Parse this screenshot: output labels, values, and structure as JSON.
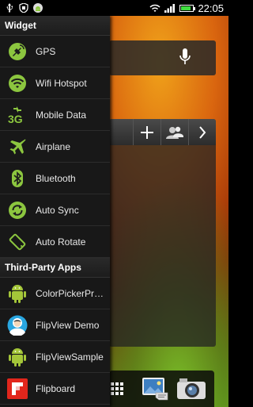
{
  "status_bar": {
    "time": "22:05",
    "icons": [
      "usb-icon",
      "security-icon",
      "android-icon",
      "wifi-icon",
      "signal-icon",
      "battery-icon"
    ],
    "battery_level": 0.85
  },
  "drawer": {
    "widget_section": {
      "title": "Widget",
      "items": [
        {
          "label": "GPS",
          "icon": "gps-icon"
        },
        {
          "label": "Wifi Hotspot",
          "icon": "wifi-hotspot-icon"
        },
        {
          "label": "Mobile Data",
          "icon": "3g-icon"
        },
        {
          "label": "Airplane",
          "icon": "airplane-icon"
        },
        {
          "label": "Bluetooth",
          "icon": "bluetooth-icon"
        },
        {
          "label": "Auto Sync",
          "icon": "sync-icon"
        },
        {
          "label": "Auto Rotate",
          "icon": "rotate-icon"
        }
      ]
    },
    "third_party_section": {
      "title": "Third-Party Apps",
      "items": [
        {
          "label": "ColorPickerPre…",
          "icon": "android-app-icon"
        },
        {
          "label": "FlipView Demo",
          "icon": "avatar-app-icon"
        },
        {
          "label": "FlipViewSample",
          "icon": "android-app-icon"
        },
        {
          "label": "Flipboard",
          "icon": "flipboard-icon"
        }
      ]
    }
  },
  "colors": {
    "accent_green": "#8cc63f",
    "drawer_bg": "#141414",
    "flipboard_red": "#e1261c",
    "avatar_blue": "#29a6e0"
  }
}
